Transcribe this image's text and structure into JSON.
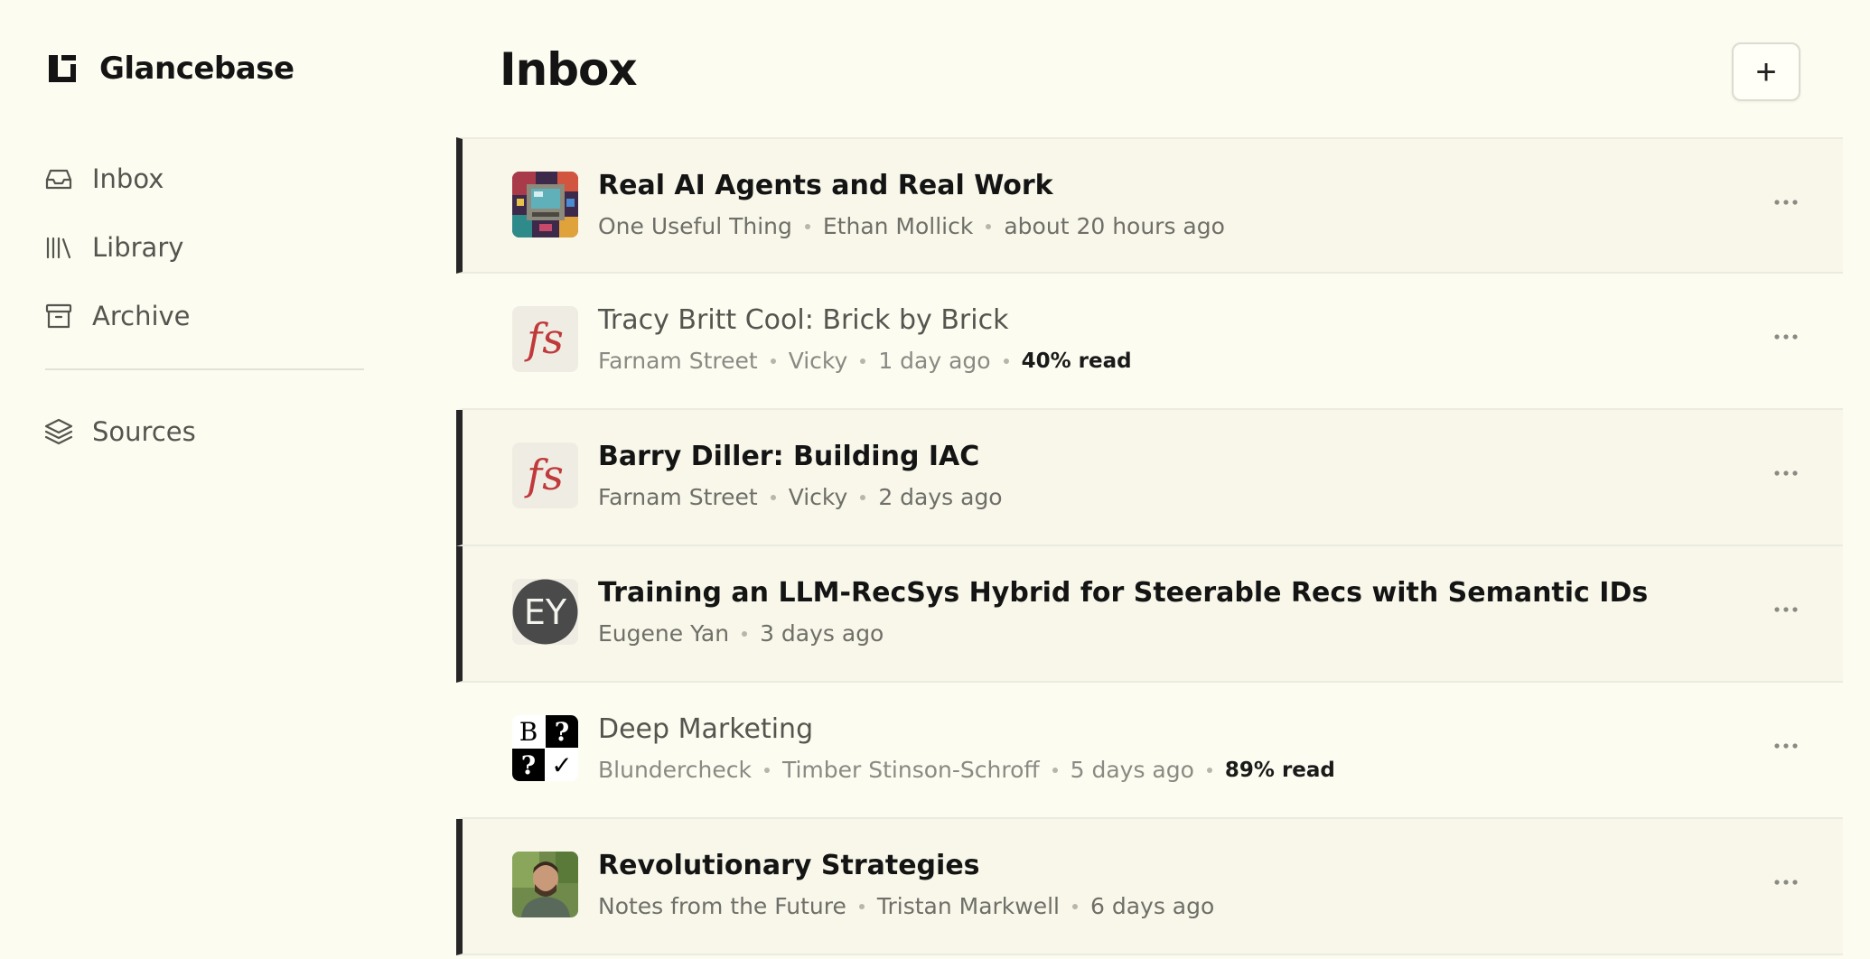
{
  "app": {
    "name": "Glancebase"
  },
  "sidebar": {
    "items": [
      {
        "label": "Inbox",
        "icon": "inbox-icon"
      },
      {
        "label": "Library",
        "icon": "library-icon"
      },
      {
        "label": "Archive",
        "icon": "archive-icon"
      }
    ],
    "secondary_items": [
      {
        "label": "Sources",
        "icon": "layers-icon"
      }
    ]
  },
  "main": {
    "title": "Inbox",
    "add_button_label": "+",
    "items": [
      {
        "title": "Real AI Agents and Real Work",
        "source": "One Useful Thing",
        "author": "Ethan Mollick",
        "time": "about 20 hours ago",
        "progress": null,
        "unread": true,
        "thumb": "pixel-art-computer"
      },
      {
        "title": "Tracy Britt Cool: Brick by Brick",
        "source": "Farnam Street",
        "author": "Vicky",
        "time": "1 day ago",
        "progress": "40% read",
        "unread": false,
        "thumb": "fs-logo"
      },
      {
        "title": "Barry Diller: Building IAC",
        "source": "Farnam Street",
        "author": "Vicky",
        "time": "2 days ago",
        "progress": null,
        "unread": true,
        "thumb": "fs-logo"
      },
      {
        "title": "Training an LLM-RecSys Hybrid for Steerable Recs with Semantic IDs",
        "source": "Eugene Yan",
        "author": null,
        "time": "3 days ago",
        "progress": null,
        "unread": true,
        "thumb": "ey-logo"
      },
      {
        "title": "Deep Marketing",
        "source": "Blundercheck",
        "author": "Timber Stinson-Schroff",
        "time": "5 days ago",
        "progress": "89% read",
        "unread": false,
        "thumb": "blundercheck-logo"
      },
      {
        "title": "Revolutionary Strategies",
        "source": "Notes from the Future",
        "author": "Tristan Markwell",
        "time": "6 days ago",
        "progress": null,
        "unread": true,
        "thumb": "portrait-photo"
      }
    ]
  },
  "colors": {
    "background": "#fdfcf0",
    "unread_row": "#f8f7ea",
    "unread_bar": "#262626",
    "fs_red": "#c0393b"
  }
}
